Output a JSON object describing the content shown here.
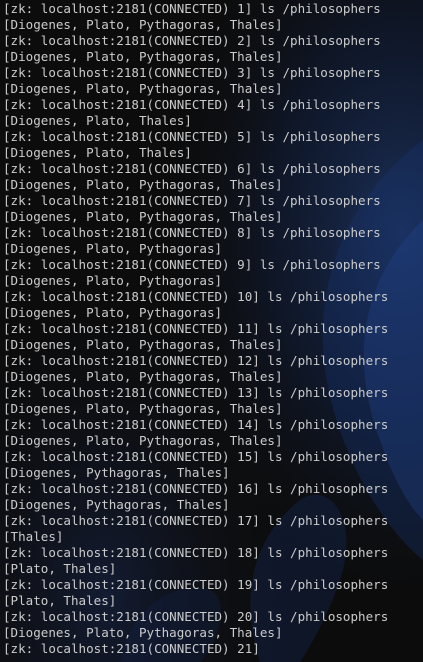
{
  "session": {
    "prompt_prefix": "[zk: localhost:2181(CONNECTED) ",
    "commands": [
      {
        "num": "1",
        "command": "ls /philosophers",
        "output": "[Diogenes, Plato, Pythagoras, Thales]"
      },
      {
        "num": "2",
        "command": "ls /philosophers",
        "output": "[Diogenes, Plato, Pythagoras, Thales]"
      },
      {
        "num": "3",
        "command": "ls /philosophers",
        "output": "[Diogenes, Plato, Pythagoras, Thales]"
      },
      {
        "num": "4",
        "command": "ls /philosophers",
        "output": "[Diogenes, Plato, Thales]"
      },
      {
        "num": "5",
        "command": "ls /philosophers",
        "output": "[Diogenes, Plato, Thales]"
      },
      {
        "num": "6",
        "command": "ls /philosophers",
        "output": "[Diogenes, Plato, Pythagoras, Thales]"
      },
      {
        "num": "7",
        "command": "ls /philosophers",
        "output": "[Diogenes, Plato, Pythagoras, Thales]"
      },
      {
        "num": "8",
        "command": "ls /philosophers",
        "output": "[Diogenes, Plato, Pythagoras]"
      },
      {
        "num": "9",
        "command": "ls /philosophers",
        "output": "[Diogenes, Plato, Pythagoras]"
      },
      {
        "num": "10",
        "command": "ls /philosophers",
        "output": "[Diogenes, Plato, Pythagoras]"
      },
      {
        "num": "11",
        "command": "ls /philosophers",
        "output": "[Diogenes, Plato, Pythagoras, Thales]"
      },
      {
        "num": "12",
        "command": "ls /philosophers",
        "output": "[Diogenes, Plato, Pythagoras, Thales]"
      },
      {
        "num": "13",
        "command": "ls /philosophers",
        "output": "[Diogenes, Plato, Pythagoras, Thales]"
      },
      {
        "num": "14",
        "command": "ls /philosophers",
        "output": "[Diogenes, Plato, Pythagoras, Thales]"
      },
      {
        "num": "15",
        "command": "ls /philosophers",
        "output": "[Diogenes, Pythagoras, Thales]"
      },
      {
        "num": "16",
        "command": "ls /philosophers",
        "output": "[Diogenes, Pythagoras, Thales]"
      },
      {
        "num": "17",
        "command": "ls /philosophers",
        "output": "[Thales]"
      },
      {
        "num": "18",
        "command": "ls /philosophers",
        "output": "[Plato, Thales]"
      },
      {
        "num": "19",
        "command": "ls /philosophers",
        "output": "[Plato, Thales]"
      },
      {
        "num": "20",
        "command": "ls /philosophers",
        "output": "[Diogenes, Plato, Pythagoras, Thales]"
      }
    ],
    "current_prompt_num": "21"
  },
  "colors": {
    "background": "#0c0c0c",
    "text": "#cccccc",
    "wallpaper_accent": "#1a3a7a"
  }
}
